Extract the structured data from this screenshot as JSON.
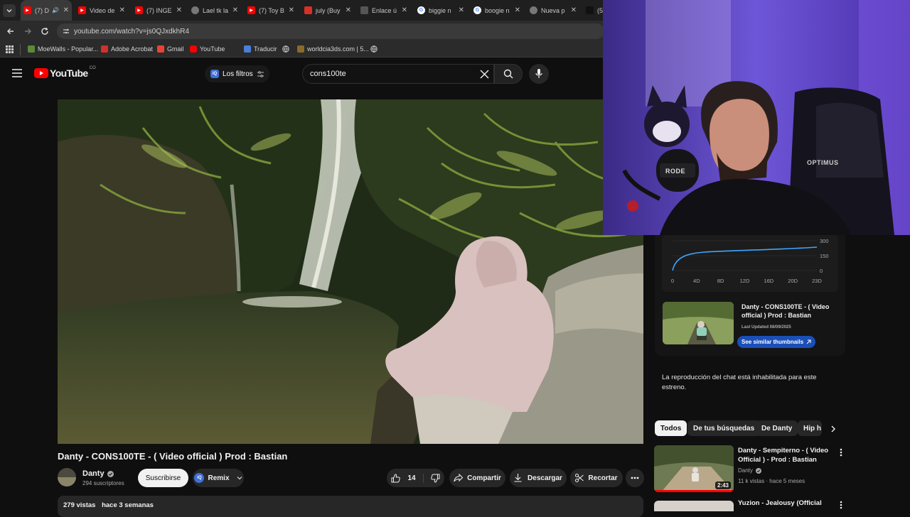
{
  "browser": {
    "tabs": [
      {
        "label": "(7) D",
        "active": true,
        "icon": "youtube-icon"
      },
      {
        "label": "Video de",
        "icon": "youtube-icon"
      },
      {
        "label": "(7) INGE",
        "icon": "youtube-icon"
      },
      {
        "label": "Lael tk la",
        "icon": "globe-icon"
      },
      {
        "label": "(7) Toy B",
        "icon": "youtube-icon"
      },
      {
        "label": "july (Buy",
        "icon": "bookmark-icon"
      },
      {
        "label": "Enlace ú",
        "icon": "link-icon"
      },
      {
        "label": "biggie n",
        "icon": "google-icon"
      },
      {
        "label": "boogie n",
        "icon": "google-icon"
      },
      {
        "label": "Nueva p",
        "icon": "chrome-icon"
      },
      {
        "label": "(5",
        "icon": "tiktok-icon"
      }
    ],
    "url": "youtube.com/watch?v=js0QJxdkhR4",
    "bookmarks": [
      "MoeWalls - Popular...",
      "Adobe Acrobat",
      "Gmail",
      "YouTube",
      "Traducir",
      "",
      "worldcia3ds.com | 5...",
      ""
    ]
  },
  "youtube": {
    "logo_text": "YouTube",
    "logo_country": "CO",
    "filters_label": "Los filtros",
    "search_value": "cons100te",
    "video_title": "Danty - CONS100TE - ( Video official ) Prod : Bastian",
    "channel_name": "Danty",
    "subscribers": "294 suscriptores",
    "subscribe_label": "Suscribirse",
    "remix_label": "Remix",
    "likes": "14",
    "share_label": "Compartir",
    "download_label": "Descargar",
    "clip_label": "Recortar",
    "views": "279 vistas",
    "age": "hace 3 semanas"
  },
  "stats_widget": {
    "y_ticks": [
      "300",
      "150",
      "0"
    ],
    "x_ticks": [
      "0",
      "4D",
      "8D",
      "12D",
      "16D",
      "20D",
      "23D"
    ],
    "thumb_title": "Danty - CONS100TE - ( Video official ) Prod : Bastian",
    "last_updated": "Last Updated 08/09/2025",
    "similar_label": "See similar thumbnails"
  },
  "chat_notice": "La reproducción del chat está inhabilitada para este estreno.",
  "chips": [
    "Todos",
    "De tus búsquedas",
    "De Danty",
    "Hip h"
  ],
  "recommendations": [
    {
      "title": "Danty - Sempiterno - ( Video Official ) - Prod : Bastian",
      "channel": "Danty",
      "meta": "11 k vistas · hace 5 meses",
      "duration": "2:43"
    },
    {
      "title": "Yuzion - Jealousy (Official",
      "channel": "",
      "meta": "",
      "duration": ""
    }
  ],
  "webcam_text": {
    "mic_brand": "RODE",
    "chair_brand": "OPTIMUS"
  },
  "colors": {
    "yt_red": "#ff0000",
    "accent_blue": "#3ea6ff",
    "chip_active": "#f1f1f1"
  }
}
